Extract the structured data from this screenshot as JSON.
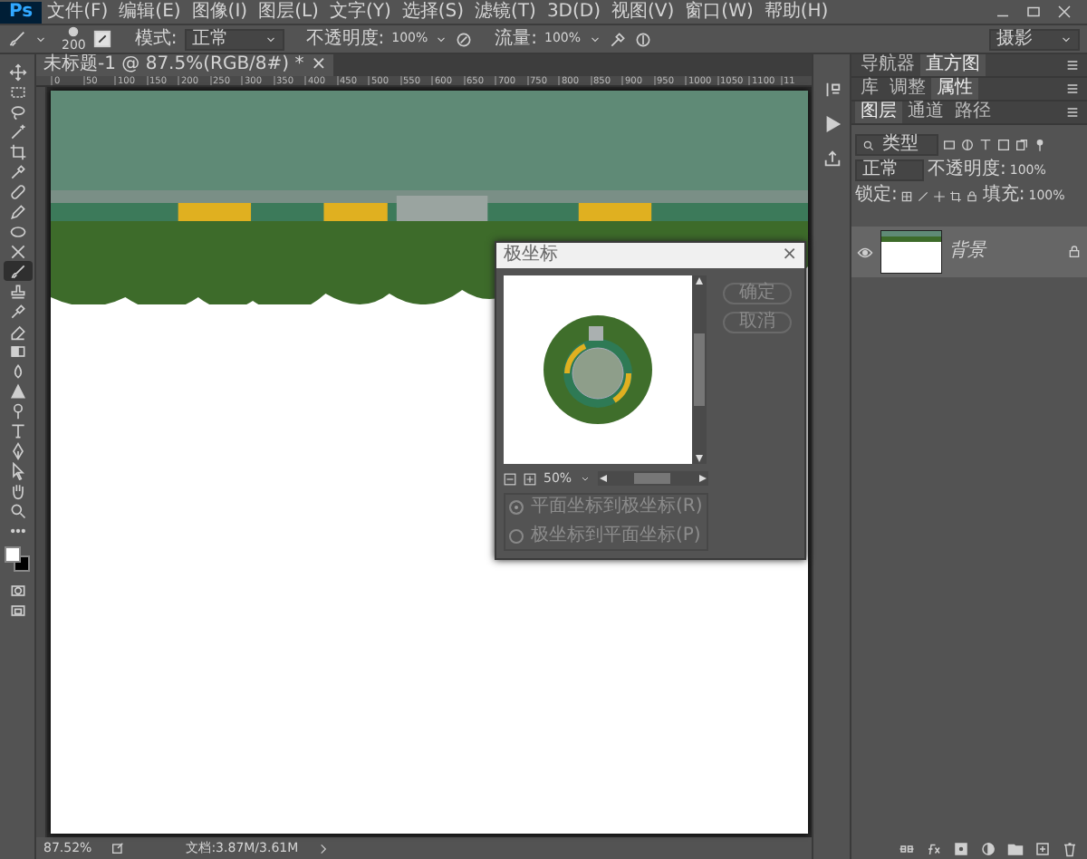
{
  "app": {
    "logo": "Ps"
  },
  "menu": [
    "文件(F)",
    "编辑(E)",
    "图像(I)",
    "图层(L)",
    "文字(Y)",
    "选择(S)",
    "滤镜(T)",
    "3D(D)",
    "视图(V)",
    "窗口(W)",
    "帮助(H)"
  ],
  "options_bar": {
    "brush_size": "200",
    "mode_label": "模式:",
    "mode": "正常",
    "opacity_label": "不透明度:",
    "opacity": "100%",
    "flow_label": "流量:",
    "flow": "100%",
    "workspace": "摄影"
  },
  "document": {
    "tab": "未标题-1 @ 87.5%(RGB/8#) *",
    "tab_close": "×",
    "ruler_labels": [
      "0",
      "50",
      "100",
      "150",
      "200",
      "250",
      "300",
      "350",
      "400",
      "450",
      "500",
      "550",
      "600",
      "650",
      "700",
      "750",
      "800",
      "850",
      "900",
      "950",
      "1000",
      "1050",
      "1100",
      "11"
    ]
  },
  "tools": [
    {
      "selected": false
    },
    {
      "selected": false
    },
    {
      "selected": false
    },
    {
      "selected": false
    },
    {
      "selected": false
    },
    {
      "selected": false
    },
    {
      "selected": false
    },
    {
      "selected": false
    },
    {
      "selected": false
    },
    {
      "selected": false
    },
    {
      "selected": true
    },
    {
      "selected": false
    },
    {
      "selected": false
    },
    {
      "selected": false
    },
    {
      "selected": false
    },
    {
      "selected": false
    },
    {
      "selected": false
    },
    {
      "selected": false
    },
    {
      "selected": false
    },
    {
      "selected": false
    },
    {
      "selected": false
    },
    {
      "selected": false
    },
    {
      "selected": false
    },
    {
      "selected": false
    },
    {
      "selected": false
    },
    {
      "selected": false
    }
  ],
  "status_bar": {
    "zoom": "87.52%",
    "document_size": "文档:3.87M/3.61M"
  },
  "panels": [
    {
      "tabs": [
        {
          "label": "导航器",
          "selected": false
        },
        {
          "label": "直方图",
          "selected": true
        }
      ]
    },
    {
      "tabs": [
        {
          "label": "库",
          "selected": false
        },
        {
          "label": "调整",
          "selected": false
        },
        {
          "label": "属性",
          "selected": true
        }
      ]
    },
    {
      "tabs": [
        {
          "label": "图层",
          "selected": true
        },
        {
          "label": "通道",
          "selected": false
        },
        {
          "label": "路径",
          "selected": false
        }
      ]
    }
  ],
  "layers": {
    "filter": "类型",
    "blend_mode": "正常",
    "opacity_label": "不透明度:",
    "opacity": "100%",
    "lock_label": "锁定:",
    "fill_label": "填充:",
    "fill": "100%",
    "items": [
      {
        "name": "背景",
        "visible": true,
        "locked": true,
        "selected": true
      }
    ]
  },
  "dialog": {
    "title": "极坐标",
    "close": "×",
    "zoom": "50%",
    "buttons": [
      {
        "label": "确定"
      },
      {
        "label": "取消"
      }
    ],
    "options": [
      {
        "label": "平面坐标到极坐标(R)",
        "selected": true
      },
      {
        "label": "极坐标到平面坐标(P)",
        "selected": false
      }
    ]
  }
}
